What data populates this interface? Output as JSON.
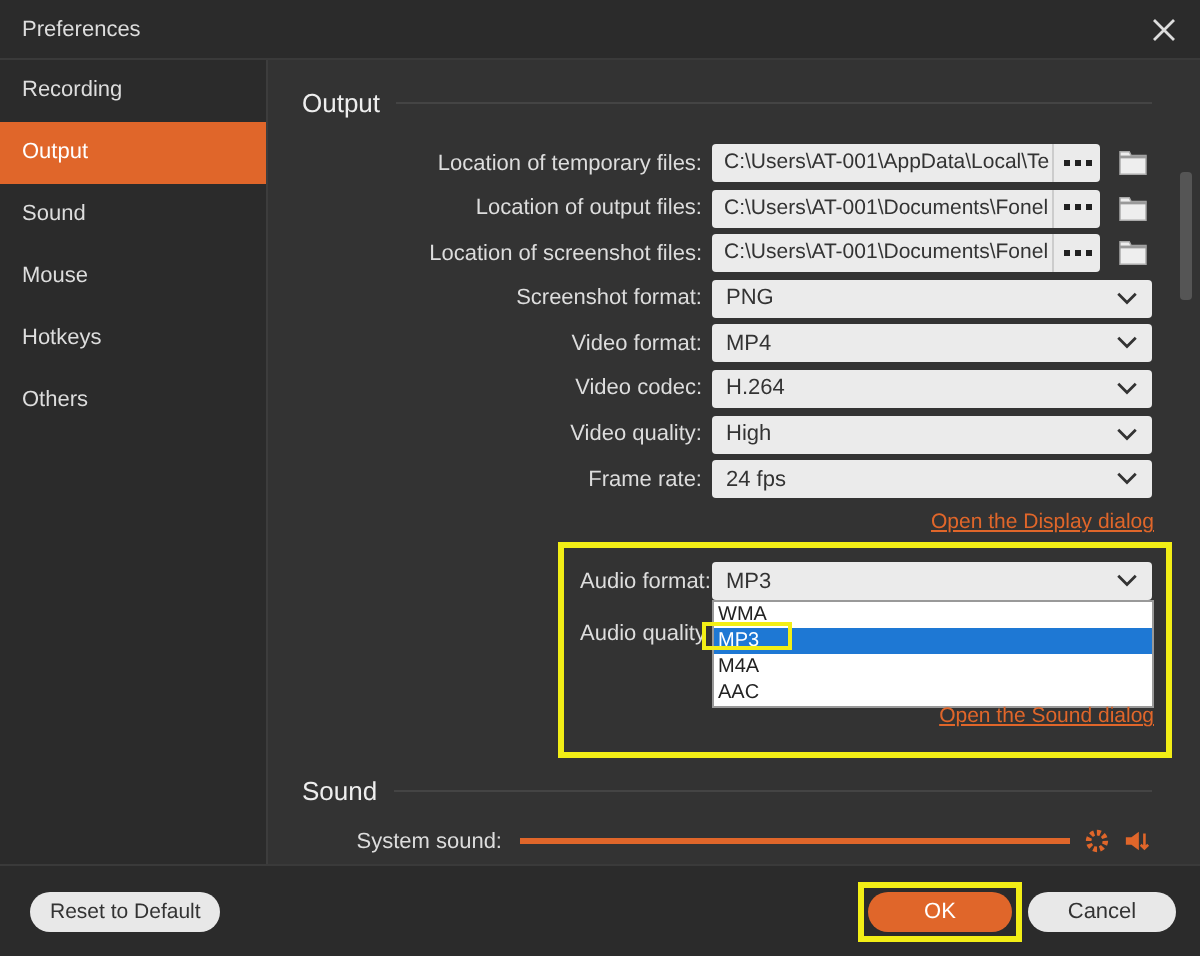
{
  "window": {
    "title": "Preferences"
  },
  "sidebar": {
    "items": [
      {
        "label": "Recording",
        "selected": false
      },
      {
        "label": "Output",
        "selected": true
      },
      {
        "label": "Sound",
        "selected": false
      },
      {
        "label": "Mouse",
        "selected": false
      },
      {
        "label": "Hotkeys",
        "selected": false
      },
      {
        "label": "Others",
        "selected": false
      }
    ]
  },
  "output": {
    "heading": "Output",
    "path_rows": [
      {
        "label": "Location of temporary files:",
        "value": "C:\\Users\\AT-001\\AppData\\Local\\Te"
      },
      {
        "label": "Location of output files:",
        "value": "C:\\Users\\AT-001\\Documents\\Fonel"
      },
      {
        "label": "Location of screenshot files:",
        "value": "C:\\Users\\AT-001\\Documents\\Fonel"
      }
    ],
    "select_rows": [
      {
        "label": "Screenshot format:",
        "value": "PNG"
      },
      {
        "label": "Video format:",
        "value": "MP4"
      },
      {
        "label": "Video codec:",
        "value": "H.264"
      },
      {
        "label": "Video quality:",
        "value": "High"
      },
      {
        "label": "Frame rate:",
        "value": "24 fps"
      }
    ],
    "display_link": "Open the Display dialog",
    "audio_format": {
      "label": "Audio format:",
      "value": "MP3",
      "options": [
        {
          "label": "WMA",
          "selected": false
        },
        {
          "label": "MP3",
          "selected": true
        },
        {
          "label": "M4A",
          "selected": false
        },
        {
          "label": "AAC",
          "selected": false
        }
      ]
    },
    "audio_quality": {
      "label": "Audio quality"
    },
    "sound_link": "Open the Sound dialog"
  },
  "sound": {
    "heading": "Sound",
    "system_sound": {
      "label": "System sound:",
      "level": 1
    }
  },
  "footer": {
    "reset": "Reset to Default",
    "ok": "OK",
    "cancel": "Cancel"
  }
}
